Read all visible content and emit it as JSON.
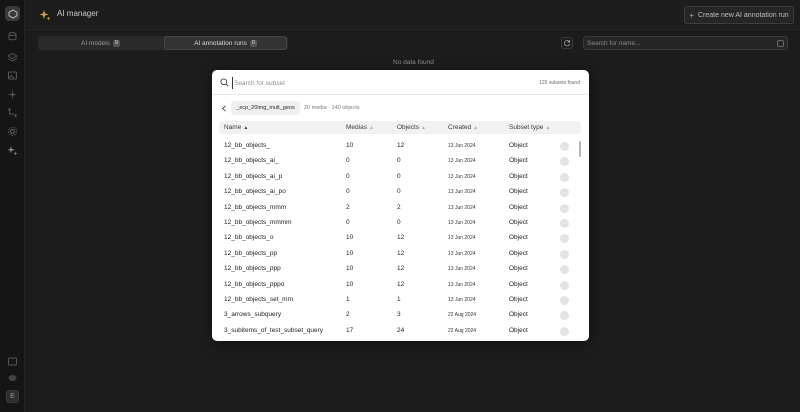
{
  "header": {
    "title": "AI manager",
    "create_button": "Create new AI annotation run",
    "create_icon": "plus-icon"
  },
  "sidebar": {
    "icons": [
      "logo-icon",
      "database-icon",
      "layers-icon",
      "image-icon",
      "sparkle-icon",
      "workflow-icon",
      "settings-icon",
      "ai-manager-icon",
      "help-icon",
      "chat-icon"
    ],
    "avatar_initial": "E"
  },
  "tabs": [
    {
      "label": "AI models",
      "count": "9",
      "active": false
    },
    {
      "label": "AI annotation runs",
      "count": "0",
      "active": true
    }
  ],
  "top_search": {
    "placeholder": "Search for name..."
  },
  "empty_state": "No data found",
  "modal": {
    "search_placeholder": "Search for subset",
    "found_text": "126 subsets found",
    "chip": "_ecp_20img_mult_geos",
    "chip_meta": "20 media · 140 objects",
    "columns": [
      {
        "label": "Name",
        "sort": "asc"
      },
      {
        "label": "Medias",
        "sort": "none"
      },
      {
        "label": "Objects",
        "sort": "none"
      },
      {
        "label": "Created",
        "sort": "none"
      },
      {
        "label": "Subset type",
        "sort": "none"
      }
    ],
    "rows": [
      {
        "name": "12_bb_objects_",
        "medias": "10",
        "objects": "12",
        "created": "13 Jun 2024",
        "type": "Object"
      },
      {
        "name": "12_bb_objects_ai_",
        "medias": "0",
        "objects": "0",
        "created": "13 Jun 2024",
        "type": "Object"
      },
      {
        "name": "12_bb_objects_ai_p",
        "medias": "0",
        "objects": "0",
        "created": "13 Jun 2024",
        "type": "Object"
      },
      {
        "name": "12_bb_objects_ai_po",
        "medias": "0",
        "objects": "0",
        "created": "13 Jun 2024",
        "type": "Object"
      },
      {
        "name": "12_bb_objects_mmm",
        "medias": "2",
        "objects": "2",
        "created": "13 Jun 2024",
        "type": "Object"
      },
      {
        "name": "12_bb_objects_mmmm",
        "medias": "0",
        "objects": "0",
        "created": "13 Jun 2024",
        "type": "Object"
      },
      {
        "name": "12_bb_objects_o",
        "medias": "10",
        "objects": "12",
        "created": "13 Jun 2024",
        "type": "Object"
      },
      {
        "name": "12_bb_objects_pp",
        "medias": "10",
        "objects": "12",
        "created": "13 Jun 2024",
        "type": "Object"
      },
      {
        "name": "12_bb_objects_ppp",
        "medias": "10",
        "objects": "12",
        "created": "13 Jun 2024",
        "type": "Object"
      },
      {
        "name": "12_bb_objects_pppo",
        "medias": "10",
        "objects": "12",
        "created": "13 Jun 2024",
        "type": "Object"
      },
      {
        "name": "12_bb_objects_set_mm",
        "medias": "1",
        "objects": "1",
        "created": "13 Jun 2024",
        "type": "Object"
      },
      {
        "name": "3_arrows_subquery",
        "medias": "2",
        "objects": "3",
        "created": "22 Aug 2024",
        "type": "Object"
      },
      {
        "name": "3_subitems_of_test_subset_query",
        "medias": "17",
        "objects": "24",
        "created": "22 Aug 2024",
        "type": "Object"
      }
    ]
  }
}
